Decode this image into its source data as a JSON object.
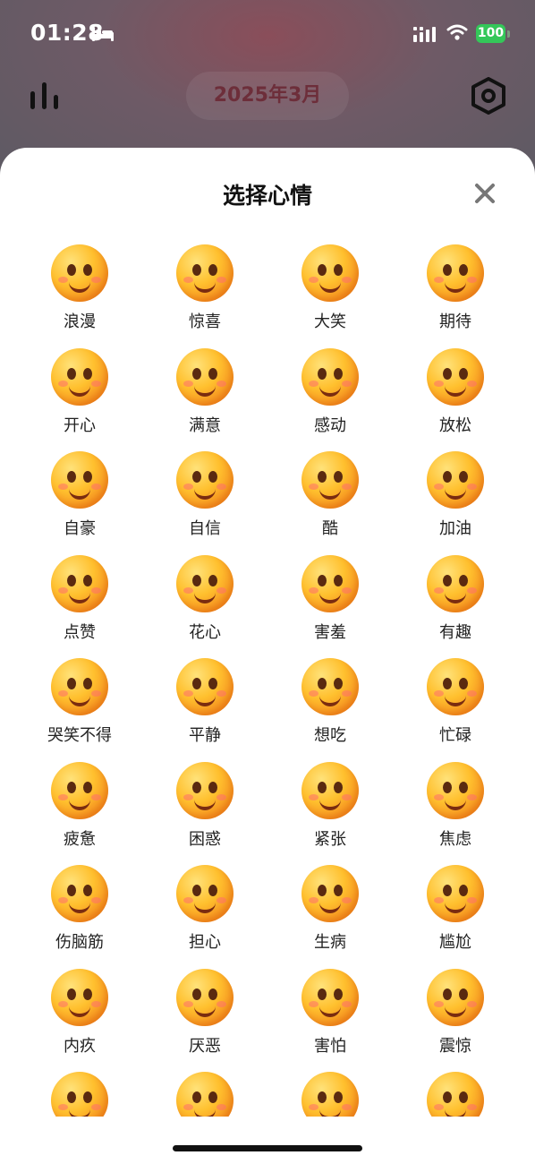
{
  "status_bar": {
    "time": "01:28",
    "battery": "100",
    "icons": [
      "bed-icon",
      "signal-icon",
      "wifi-icon",
      "battery-icon"
    ]
  },
  "header": {
    "month": "2025年3月",
    "left_icon": "stats-icon",
    "right_icon": "settings-icon"
  },
  "sheet": {
    "title": "选择心情",
    "close_icon": "close-icon"
  },
  "moods": [
    "浪漫",
    "惊喜",
    "大笑",
    "期待",
    "开心",
    "满意",
    "感动",
    "放松",
    "自豪",
    "自信",
    "酷",
    "加油",
    "点赞",
    "花心",
    "害羞",
    "有趣",
    "哭笑不得",
    "平静",
    "想吃",
    "忙碌",
    "疲惫",
    "困惑",
    "紧张",
    "焦虑",
    "伤脑筋",
    "担心",
    "生病",
    "尴尬",
    "内疚",
    "厌恶",
    "害怕",
    "震惊",
    "",
    "",
    "",
    ""
  ],
  "colors": {
    "accent_month": "#6d2e3a",
    "battery": "#34c759",
    "emoji_base": "#ffc02e"
  }
}
